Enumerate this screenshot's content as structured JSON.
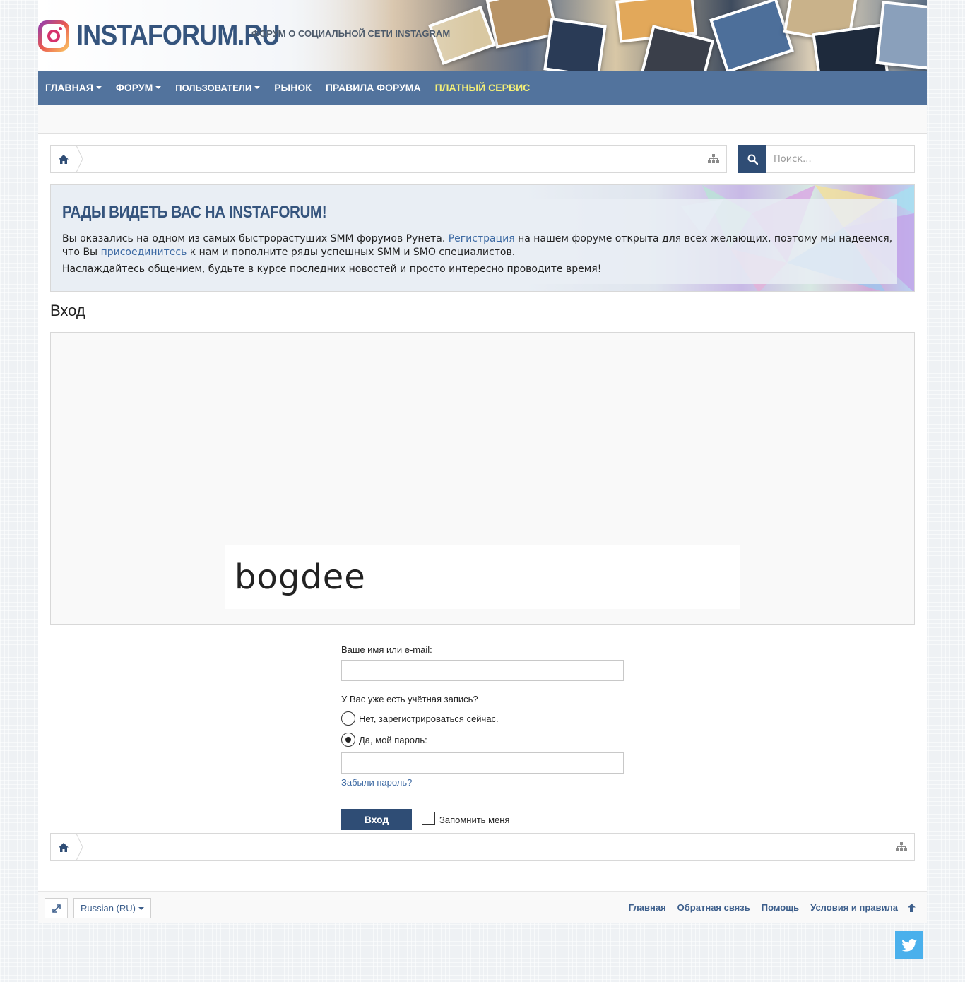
{
  "header": {
    "logo_text": "INSTAFORUM.RU",
    "tagline": "ФОРУМ О СОЦИАЛЬНОЙ СЕТИ INSTAGRAM"
  },
  "nav": {
    "items": [
      {
        "label": "ГЛАВНАЯ",
        "dropdown": true
      },
      {
        "label": "ФОРУМ",
        "dropdown": true
      },
      {
        "label": "ПОЛЬЗОВАТЕЛИ",
        "dropdown": true
      },
      {
        "label": "РЫНОК",
        "dropdown": false
      },
      {
        "label": "ПРАВИЛА ФОРУМА",
        "dropdown": false
      },
      {
        "label": "ПЛАТНЫЙ СЕРВИС",
        "dropdown": false
      }
    ]
  },
  "search": {
    "placeholder": "Поиск..."
  },
  "notice": {
    "title": "Рады видеть вас на InstaForum!",
    "p1_before": "Вы оказались на одном из самых быстрорастущих SMM форумов Рунета. ",
    "p1_link1": "Регистрация",
    "p1_middle": " на нашем форуме открыта для всех желающих, поэтому мы надеемся, что Вы ",
    "p1_link2": "присоединитесь",
    "p1_after": " к нам и пополните ряды успешных SMM и SMO специалистов.",
    "p2": "Наслаждайтесь общением, будьте в курсе последних новостей и просто интересно проводите время!"
  },
  "page": {
    "title": "Вход"
  },
  "captcha": {
    "word": "bogdee"
  },
  "form": {
    "username_label": "Ваше имя или e-mail:",
    "account_question": "У Вас уже есть учётная запись?",
    "option_no": "Нет, зарегистрироваться сейчас.",
    "option_yes": "Да, мой пароль:",
    "forgot": "Забыли пароль?",
    "submit": "Вход",
    "remember": "Запомнить меня"
  },
  "footer": {
    "language": "Russian (RU)",
    "links": [
      "Главная",
      "Обратная связь",
      "Помощь",
      "Условия и правила"
    ]
  },
  "colors": {
    "nav_bg": "#52739d",
    "brand": "#35547d",
    "button": "#2f4d75",
    "paid_service": "#f5f077",
    "link": "#3d6aa3",
    "twitter": "#4ab0ec"
  },
  "icons": [
    "instagram-logo-icon",
    "home-icon",
    "sitemap-icon",
    "search-icon",
    "expand-icon",
    "arrow-up-icon",
    "twitter-icon"
  ]
}
